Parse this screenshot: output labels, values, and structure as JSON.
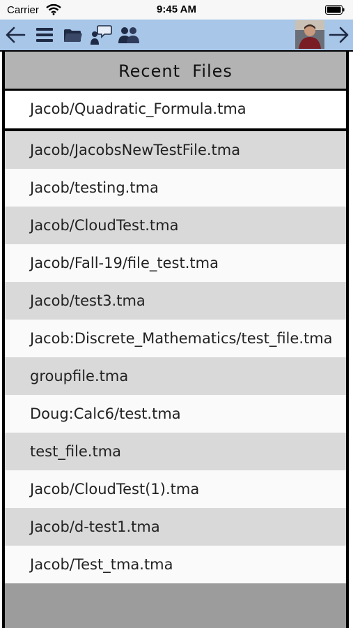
{
  "status_bar": {
    "carrier": "Carrier",
    "time": "9:45 AM"
  },
  "toolbar": {
    "icons": [
      "back-arrow-icon",
      "menu-icon",
      "folder-icon",
      "chat-icon",
      "group-icon",
      "avatar",
      "forward-arrow-icon"
    ]
  },
  "panel": {
    "title": "Recent  Files",
    "selected_file": "Jacob/Quadratic_Formula.tma",
    "files": [
      "Jacob/JacobsNewTestFile.tma",
      "Jacob/testing.tma",
      "Jacob/CloudTest.tma",
      "Jacob/Fall-19/file_test.tma",
      "Jacob/test3.tma",
      "Jacob:Discrete_Mathematics/test_file.tma",
      "groupfile.tma",
      "Doug:Calc6/test.tma",
      "test_file.tma",
      "Jacob/CloudTest(1).tma",
      "Jacob/d-test1.tma",
      "Jacob/Test_tma.tma"
    ]
  }
}
